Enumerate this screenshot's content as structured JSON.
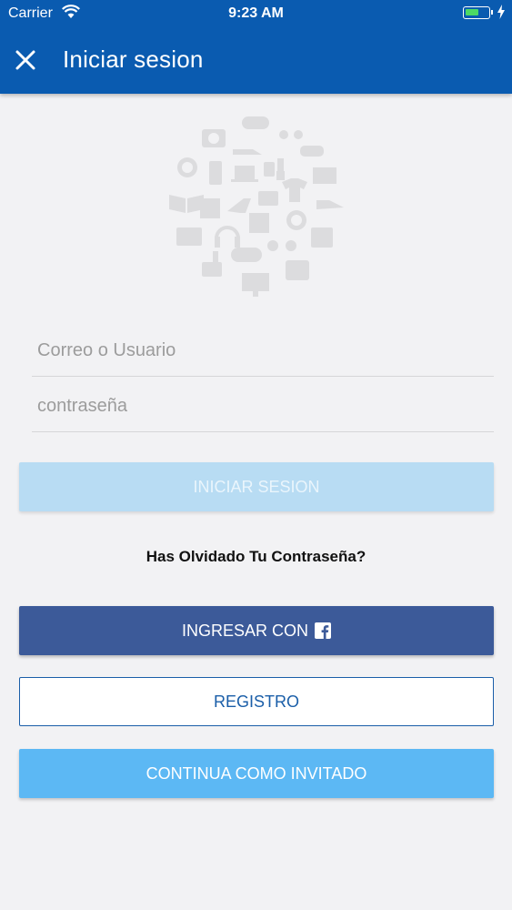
{
  "status_bar": {
    "carrier": "Carrier",
    "time": "9:23 AM"
  },
  "header": {
    "title": "Iniciar sesion",
    "close_icon": "close-icon"
  },
  "illustration": {
    "name": "shopping-icons-circle"
  },
  "form": {
    "user_placeholder": "Correo o Usuario",
    "user_value": "",
    "password_placeholder": "contraseña",
    "password_value": ""
  },
  "buttons": {
    "login": "INICIAR SESION",
    "forgot": "Has Olvidado Tu Contraseña?",
    "facebook": "INGRESAR CON",
    "register": "REGISTRO",
    "guest": "CONTINUA COMO INVITADO"
  },
  "colors": {
    "appbar": "#0a5bb0",
    "facebook": "#3c5a99",
    "login_disabled": "#b8dcf3",
    "guest": "#5cb8f4",
    "register_border": "#1a5ea8"
  }
}
